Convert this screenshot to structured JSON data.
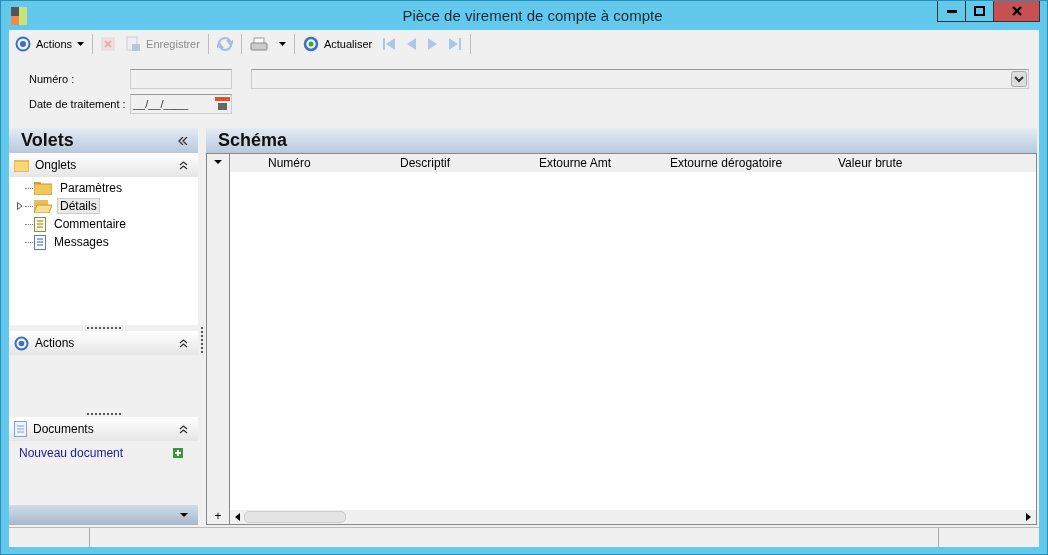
{
  "window": {
    "title": "Pièce de virement de compte à compte"
  },
  "toolbar": {
    "items": [
      {
        "kind": "menu",
        "label": "Actions",
        "disabled": false
      },
      {
        "kind": "separator"
      },
      {
        "kind": "delete",
        "disabled": true
      },
      {
        "kind": "save",
        "label": "Enregistrer",
        "disabled": true
      },
      {
        "kind": "separator"
      },
      {
        "kind": "sync",
        "disabled": true
      },
      {
        "kind": "separator"
      },
      {
        "kind": "print",
        "disabled": false
      },
      {
        "kind": "separator"
      },
      {
        "kind": "refresh",
        "label": "Actualiser",
        "disabled": false
      },
      {
        "kind": "first",
        "disabled": true
      },
      {
        "kind": "prev",
        "disabled": true
      },
      {
        "kind": "next",
        "disabled": true
      },
      {
        "kind": "last",
        "disabled": true
      },
      {
        "kind": "separator"
      }
    ]
  },
  "form": {
    "number_label": "Numéro :",
    "date_label": "Date de traitement :",
    "date_value": "__/__/____"
  },
  "sidebar": {
    "title": "Volets",
    "tabs_section": {
      "title": "Onglets",
      "items": [
        {
          "kind": "folder",
          "label": "Paramètres",
          "selected": false
        },
        {
          "kind": "folder-open",
          "label": "Détails",
          "selected": true,
          "expanded": false
        },
        {
          "kind": "note",
          "label": "Commentaire",
          "selected": false
        },
        {
          "kind": "document",
          "label": "Messages",
          "selected": false
        }
      ]
    },
    "actions_section": {
      "title": "Actions"
    },
    "documents_section": {
      "title": "Documents",
      "link": "Nouveau document"
    }
  },
  "main": {
    "title": "Schéma",
    "add_row": "+",
    "columns": [
      "Numéro",
      "Descriptif",
      "Extourne Amt",
      "Extourne dérogatoire",
      "Valeur brute"
    ]
  }
}
